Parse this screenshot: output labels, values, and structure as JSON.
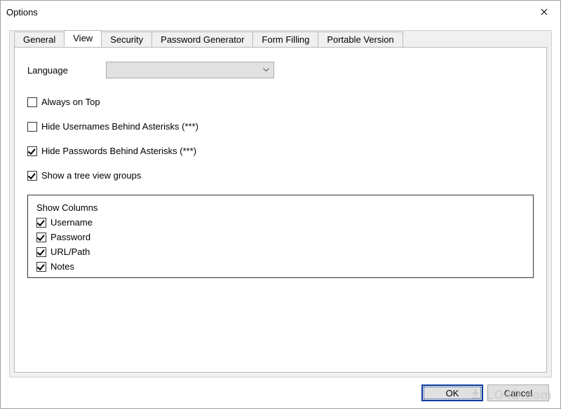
{
  "window": {
    "title": "Options"
  },
  "tabs": [
    {
      "label": "General"
    },
    {
      "label": "View"
    },
    {
      "label": "Security"
    },
    {
      "label": "Password Generator"
    },
    {
      "label": "Form Filling"
    },
    {
      "label": "Portable Version"
    }
  ],
  "activeTabIndex": 1,
  "view": {
    "languageLabel": "Language",
    "languageValue": "",
    "checks": [
      {
        "label": "Always on Top",
        "checked": false
      },
      {
        "label": "Hide Usernames Behind Asterisks (***)",
        "checked": false
      },
      {
        "label": "Hide Passwords Behind Asterisks (***)",
        "checked": true
      },
      {
        "label": "Show a tree view groups",
        "checked": true
      }
    ],
    "columnsGroup": {
      "title": "Show Columns",
      "items": [
        {
          "label": "Username",
          "checked": true
        },
        {
          "label": "Password",
          "checked": true
        },
        {
          "label": "URL/Path",
          "checked": true
        },
        {
          "label": "Notes",
          "checked": true
        }
      ]
    }
  },
  "buttons": {
    "ok": "OK",
    "cancel": "Cancel"
  },
  "watermark": "LO4D.com"
}
